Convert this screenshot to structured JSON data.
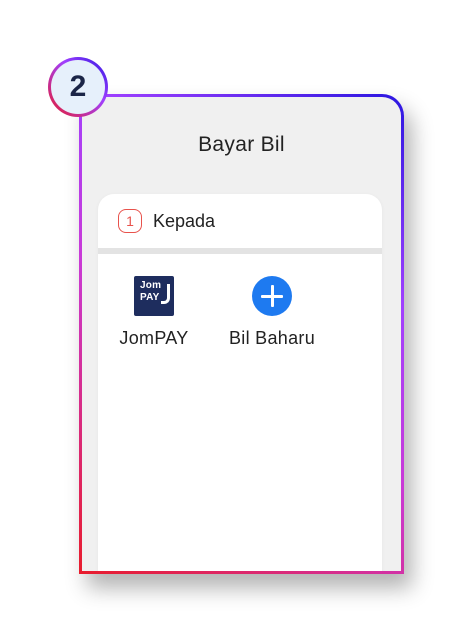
{
  "badge": {
    "number": "2"
  },
  "screen": {
    "title": "Bayar Bil"
  },
  "step": {
    "number": "1",
    "label": "Kepada"
  },
  "options": [
    {
      "label": "JomPAY",
      "icon": "jompay-logo-icon",
      "logo_text_top": "Jom",
      "logo_text_bottom": "PAY"
    },
    {
      "label": "Bil Baharu",
      "icon": "plus-circle-icon"
    }
  ],
  "colors": {
    "accent_blue": "#1e7af0",
    "step_red": "#e8524c",
    "jompay_navy": "#1e2d5e",
    "gradient_start": "#e81c2c",
    "gradient_end": "#2a16e0"
  }
}
